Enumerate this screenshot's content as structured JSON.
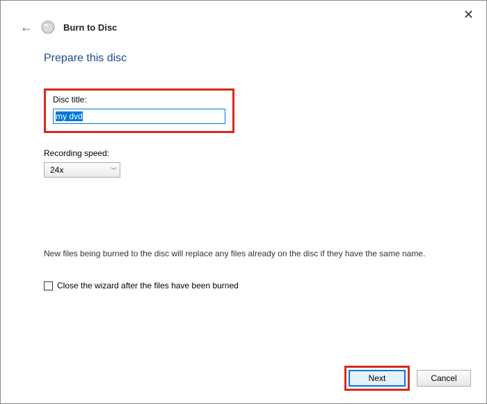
{
  "window": {
    "title": "Burn to Disc"
  },
  "page": {
    "heading": "Prepare this disc"
  },
  "fields": {
    "disc_title_label": "Disc title:",
    "disc_title_value": "my dvd",
    "recording_speed_label": "Recording speed:",
    "recording_speed_value": "24x"
  },
  "info": {
    "note": "New files being burned to the disc will replace any files already on the disc if they have the same name."
  },
  "checkbox": {
    "close_wizard_label": "Close the wizard after the files have been burned",
    "checked": false
  },
  "buttons": {
    "next": "Next",
    "cancel": "Cancel"
  }
}
